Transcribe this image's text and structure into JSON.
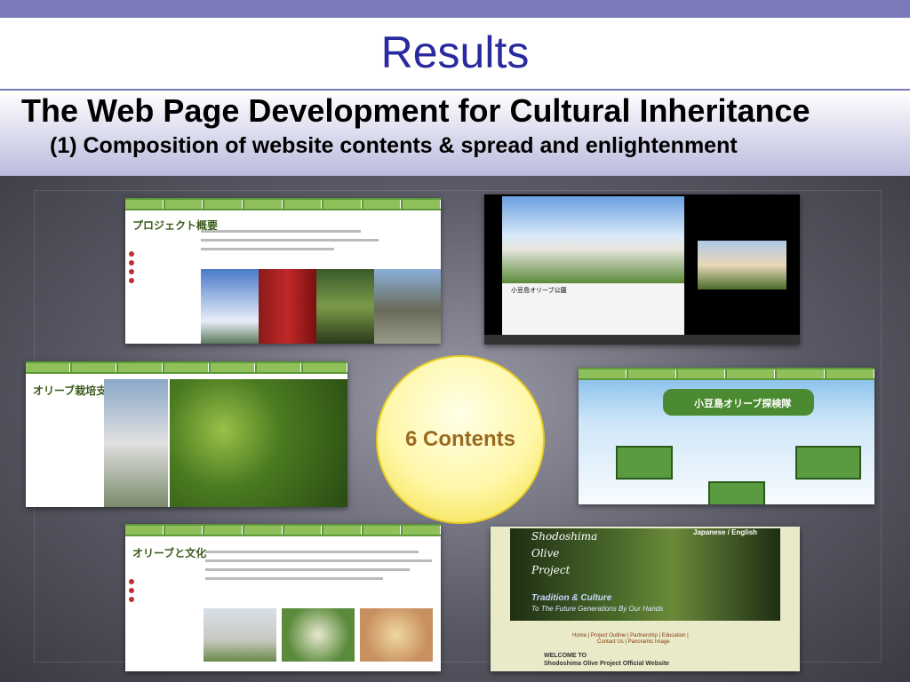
{
  "slide": {
    "title": "Results",
    "heading": "The Web Page Development for Cultural Inheritance",
    "subheading": "(1) Composition of website contents & spread and enlightenment",
    "center_label": "6 Contents"
  },
  "screenshots": [
    {
      "name": "project-outline-page",
      "jp_title": "プロジェクト概要"
    },
    {
      "name": "olive-park-page",
      "caption": "小豆島オリーブ公園"
    },
    {
      "name": "cultivation-support-page",
      "jp_title": "オリーブ栽培支援"
    },
    {
      "name": "olive-explorer-page",
      "jp_title": "小豆島オリーブ探検隊"
    },
    {
      "name": "olive-culture-page",
      "jp_title": "オリーブと文化"
    },
    {
      "name": "shodoshima-homepage",
      "lang": "Japanese / English",
      "s1": "Shodoshima",
      "s2": "Olive",
      "s3": "Project",
      "tag1": "Tradition & Culture",
      "tag2": "To The Future Generations By Our Hands",
      "menu1": "Home | Project Outline | Partnership | Education |",
      "menu2": "Contact Us | Panoramic Image",
      "welcome1": "WELCOME TO",
      "welcome2": "Shodoshima Olive Project Official Website"
    }
  ],
  "colors": {
    "accent": "#2a2aa0",
    "band": "#b9b9dd",
    "nav": "#5f9a3a"
  }
}
